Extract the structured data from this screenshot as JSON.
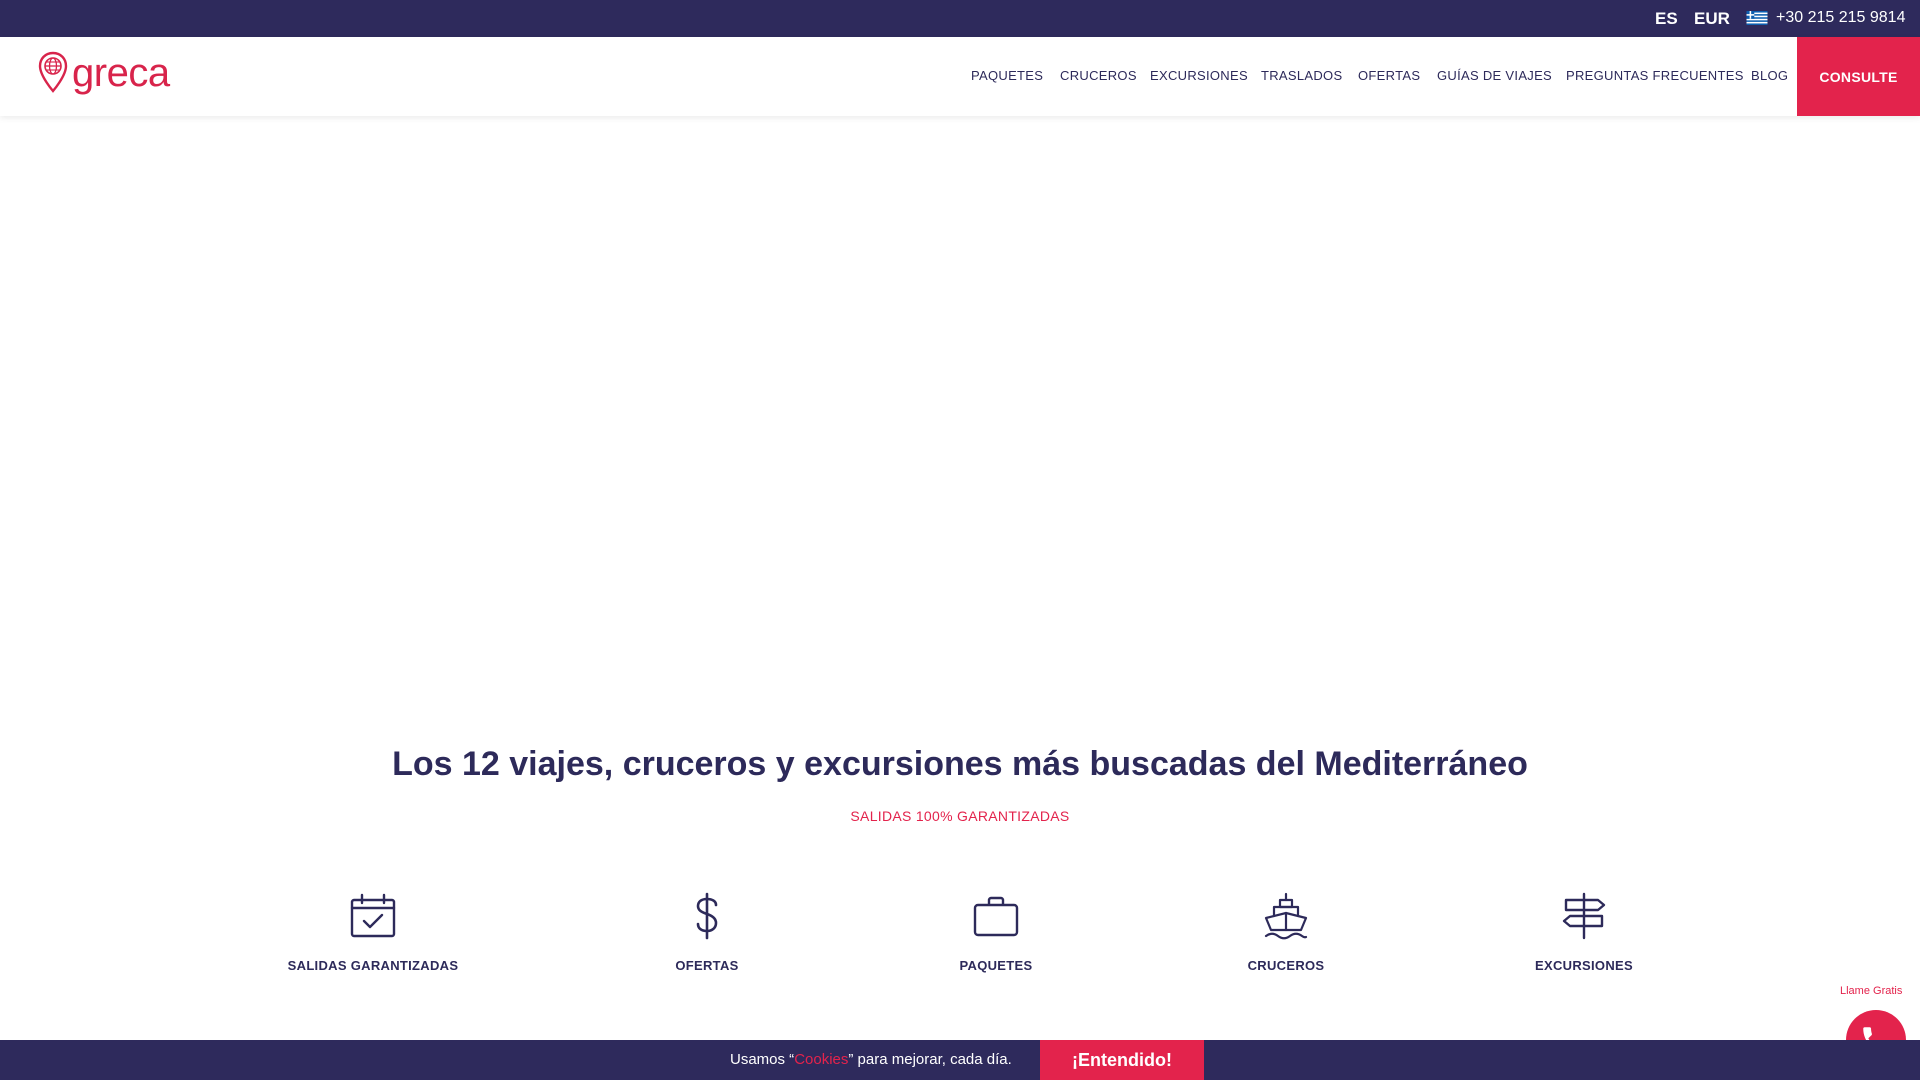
{
  "topbar": {
    "language": "ES",
    "currency": "EUR",
    "phone": "+30 215 215 9814",
    "flag_icon": "greek-flag-icon"
  },
  "header": {
    "logo_text": "greca",
    "nav": [
      {
        "label": "PAQUETES"
      },
      {
        "label": "CRUCEROS"
      },
      {
        "label": "EXCURSIONES"
      },
      {
        "label": "TRASLADOS"
      },
      {
        "label": "OFERTAS"
      },
      {
        "label": "GUÍAS DE VIAJES"
      },
      {
        "label": "PREGUNTAS FRECUENTES"
      },
      {
        "label": "BLOG"
      }
    ],
    "consulte_label": "CONSULTE"
  },
  "main": {
    "headline": "Los 12 viajes, cruceros y excursiones más buscadas del Mediterráneo",
    "subheadline": "SALIDAS 100% GARANTIZADAS",
    "features": [
      {
        "label": "SALIDAS GARANTIZADAS",
        "icon": "calendar-check-icon"
      },
      {
        "label": "OFERTAS",
        "icon": "dollar-icon"
      },
      {
        "label": "PAQUETES",
        "icon": "briefcase-icon"
      },
      {
        "label": "CRUCEROS",
        "icon": "ship-icon"
      },
      {
        "label": "EXCURSIONES",
        "icon": "signpost-icon"
      }
    ]
  },
  "call": {
    "label": "Llame Gratis",
    "icon": "phone-icon"
  },
  "cookie": {
    "text_before": "Usamos “",
    "link": "Cookies",
    "text_after": "” para mejorar, cada día.",
    "button": "¡Entendido!"
  },
  "colors": {
    "navy": "#2e2a5c",
    "accent": "#e3234c"
  }
}
